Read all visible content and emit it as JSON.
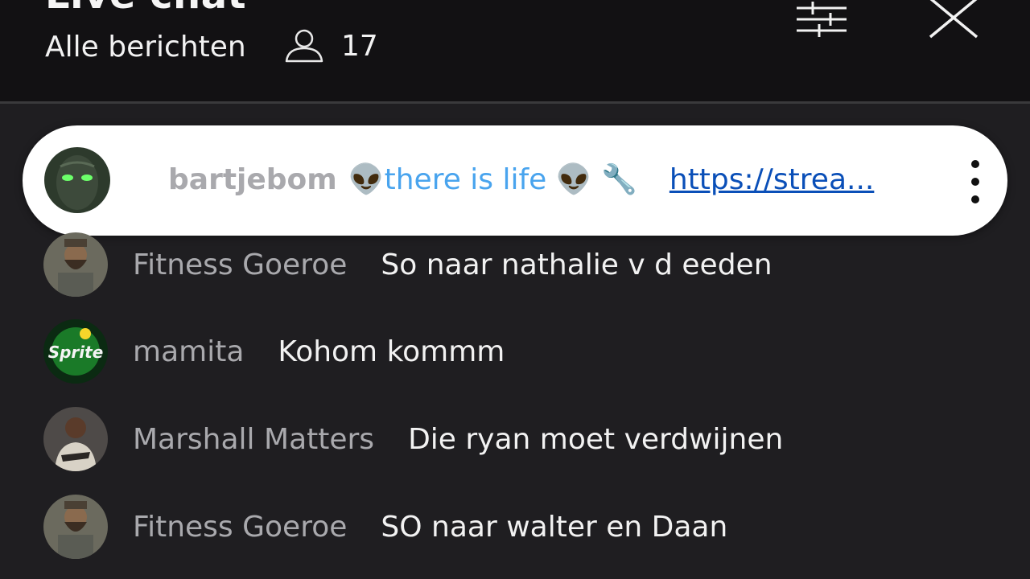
{
  "header": {
    "title": "Live chat",
    "filter_label": "Alle berichten",
    "viewer_count": "17",
    "icons": {
      "viewers": "person-icon",
      "settings": "sliders-icon",
      "close": "close-icon"
    }
  },
  "pinned": {
    "author": "bartjebom",
    "message": "👽there is life 👽 🔧",
    "link": "https://strea..."
  },
  "messages": [
    {
      "author": "Fitness Goeroe",
      "text": "So naar nathalie v d eeden"
    },
    {
      "author": "mamita",
      "text": "Kohom kommm"
    },
    {
      "author": "Marshall Matters",
      "text": "Die ryan moet verdwijnen"
    },
    {
      "author": "Fitness Goeroe",
      "text": "SO naar walter en Daan"
    }
  ],
  "colors": {
    "background": "#1f1e21",
    "header": "#121113",
    "pinned_author": "#49a4ee",
    "link": "#0a4fb8",
    "author": "#a9a9ad"
  }
}
